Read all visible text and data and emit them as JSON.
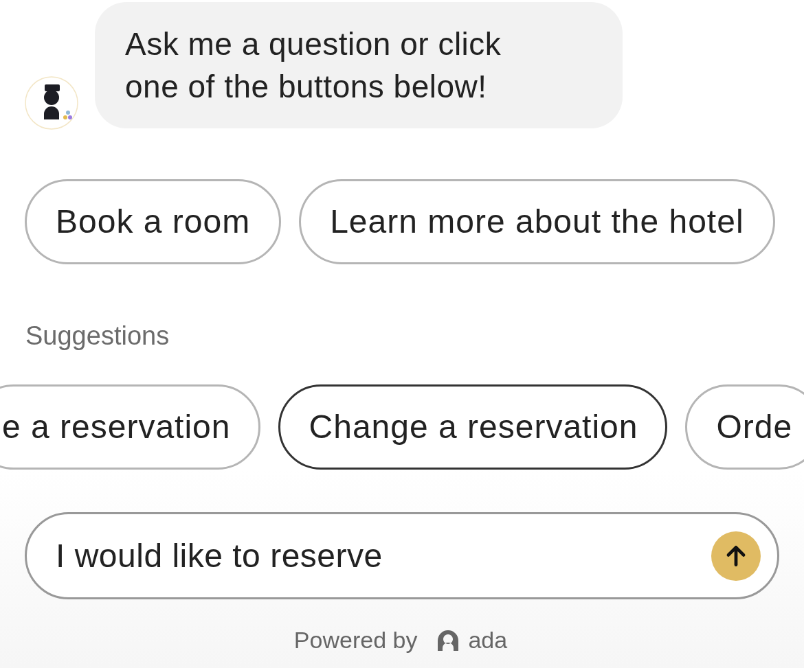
{
  "message": {
    "text": "Ask me a question or click one of the buttons below!"
  },
  "quick_replies": [
    {
      "label": "Book a room"
    },
    {
      "label": "Learn more about the hotel"
    }
  ],
  "suggestions": {
    "title": "Suggestions",
    "items": [
      {
        "label": "e a reservation",
        "selected": false
      },
      {
        "label": "Change a reservation",
        "selected": true
      },
      {
        "label": "Orde",
        "selected": false
      }
    ]
  },
  "composer": {
    "value": "I would like to reserve"
  },
  "footer": {
    "text": "Powered by",
    "brand": "ada"
  }
}
